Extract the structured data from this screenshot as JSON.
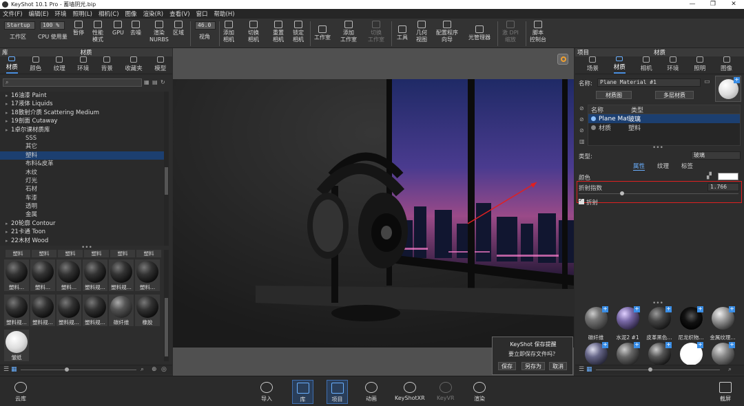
{
  "window": {
    "title": "KeyShot 10.1 Pro - 蓄墙阴光.bip",
    "min": "—",
    "max": "❐",
    "close": "✕"
  },
  "menu": [
    "文件(F)",
    "编辑(E)",
    "环境",
    "照明(L)",
    "相机(C)",
    "图像",
    "渲染(R)",
    "查看(V)",
    "窗口",
    "帮助(H)"
  ],
  "toolbar": {
    "workspace_value": "Startup",
    "cpu_value": "100 %",
    "fov_value": "46.0",
    "buttons": {
      "workspace": "工作区",
      "cpu": "CPU 使用量",
      "pause": "暂停",
      "perf": "性能\n模式",
      "gpu": "GPU",
      "denoise": "去噪",
      "nurbs": "渲染\nNURBS",
      "region": "区域",
      "view": "视角",
      "add_camera": "添加\n相机",
      "switch_camera": "切换\n相机",
      "reset_camera": "重置\n相机",
      "lock_camera": "锁定\n相机",
      "studio": "工作室",
      "add_studio": "添加\n工作室",
      "switch_studio": "切换\n工作室",
      "tools": "工具",
      "geo_view": "几何\n视图",
      "config": "配置程序\n向导",
      "light_manager": "光管理器",
      "dpi": "激 DPI\n缩放",
      "script": "脚本\n控制台"
    }
  },
  "library": {
    "header_left": "库",
    "header_title": "材质",
    "tabs": [
      {
        "label": "材质",
        "icon": "material-icon"
      },
      {
        "label": "颜色",
        "icon": "palette-icon"
      },
      {
        "label": "纹理",
        "icon": "texture-icon"
      },
      {
        "label": "环境",
        "icon": "environment-icon"
      },
      {
        "label": "背景",
        "icon": "background-icon"
      },
      {
        "label": "收藏夹",
        "icon": "favorites-icon"
      },
      {
        "label": "模型",
        "icon": "model-icon"
      }
    ],
    "search_placeholder": "",
    "tree": [
      {
        "label": "16油漆 Paint",
        "child": false
      },
      {
        "label": "17液体 Liquids",
        "child": false
      },
      {
        "label": "18散射介质 Scattering Medium",
        "child": false
      },
      {
        "label": "19剖面 Cutaway",
        "child": false
      },
      {
        "label": "1卓尔课材质库",
        "child": false
      },
      {
        "label": "SSS",
        "child": true
      },
      {
        "label": "其它",
        "child": true
      },
      {
        "label": "塑料",
        "child": true,
        "selected": true
      },
      {
        "label": "布料&皮革",
        "child": true
      },
      {
        "label": "木纹",
        "child": true
      },
      {
        "label": "灯光",
        "child": true
      },
      {
        "label": "石材",
        "child": true
      },
      {
        "label": "车漆",
        "child": true
      },
      {
        "label": "透明",
        "child": true
      },
      {
        "label": "金属",
        "child": true
      },
      {
        "label": "20轮廓 Contour",
        "child": false
      },
      {
        "label": "21卡通 Toon",
        "child": false
      },
      {
        "label": "22木材 Wood",
        "child": false
      }
    ],
    "thumb_top_labels": [
      "塑料",
      "塑料",
      "塑料",
      "塑料",
      "塑料",
      "塑料"
    ],
    "thumb_row1": [
      "塑料...",
      "塑料...",
      "塑料...",
      "塑料规...",
      "塑料规...",
      "塑料..."
    ],
    "thumb_row2": [
      "塑料规...",
      "塑料规...",
      "塑料规...",
      "塑料规...",
      "碳纤维",
      "橡胶"
    ],
    "thumb_row3": [
      "皱纸"
    ]
  },
  "project": {
    "header_left": "项目",
    "header_title": "材质",
    "tabs": [
      {
        "label": "场景",
        "icon": "scene-icon"
      },
      {
        "label": "材质",
        "icon": "material-icon"
      },
      {
        "label": "相机",
        "icon": "camera-icon"
      },
      {
        "label": "环境",
        "icon": "environment-icon"
      },
      {
        "label": "照明",
        "icon": "lighting-icon"
      },
      {
        "label": "图像",
        "icon": "image-icon"
      }
    ],
    "name_label": "名称:",
    "name_value": "Plane Material #1",
    "material_graph": "材质图",
    "multi_material": "多层材质",
    "list_headers": [
      "名称",
      "类型"
    ],
    "list_rows": [
      {
        "name": "Plane Mat",
        "type": "玻璃",
        "selected": true
      },
      {
        "name": "材质",
        "type": "塑料",
        "selected": false
      }
    ],
    "type_label": "类型:",
    "type_value": "玻璃",
    "subtabs": [
      "属性",
      "纹理",
      "标签"
    ],
    "color_label": "颜色",
    "ior_label": "折射指数",
    "ior_value": "1.766",
    "ior_fraction": 0.27,
    "refraction_label": "折射",
    "thumbs_row1": [
      "碳纤维",
      "水泥2 #1",
      "皮革黑色...",
      "尼龙织物...",
      "金属纹理..."
    ]
  },
  "dialog": {
    "title": "KeyShot 保存提醒",
    "message": "要立即保存文件吗？",
    "save": "保存",
    "save_as": "另存为",
    "cancel": "取消"
  },
  "bottom": {
    "cloud": "云库",
    "import": "导入",
    "library": "库",
    "project": "项目",
    "animation": "动画",
    "keyshotxr": "KeyShotXR",
    "keyvr": "KeyVR",
    "render": "渲染",
    "screenshot": "截屏"
  },
  "colors": {
    "accent": "#4a90e2",
    "highlight_box": "#e02020",
    "selected": "#1c3f70"
  }
}
